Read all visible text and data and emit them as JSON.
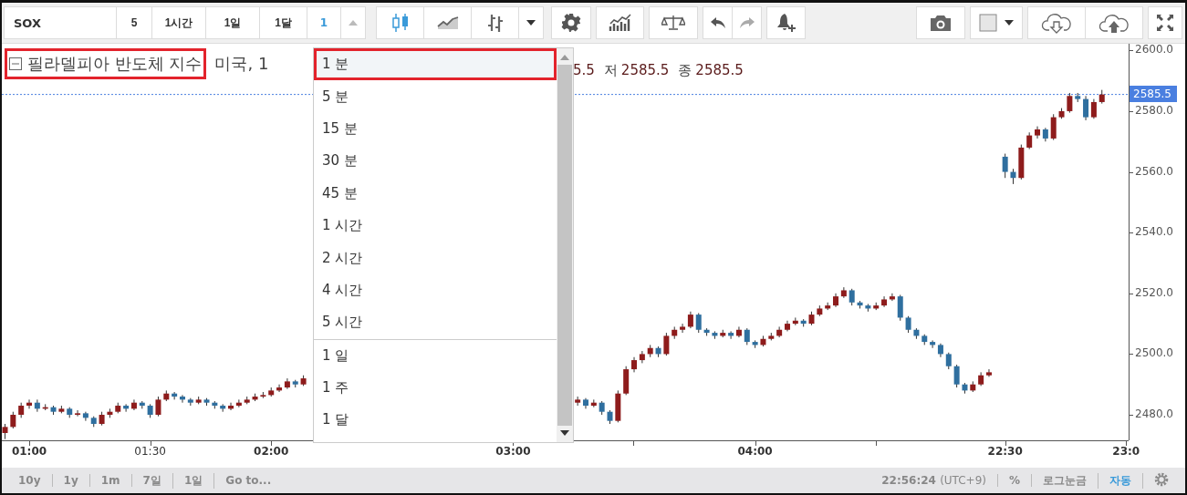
{
  "toolbar": {
    "symbol": "SOX",
    "intervals": [
      "5",
      "1시간",
      "1일",
      "1달"
    ],
    "interval_input": "1",
    "chart_styles": [
      {
        "kind": "candles",
        "selected": true
      },
      {
        "kind": "line",
        "selected": false
      },
      {
        "kind": "bars",
        "selected": false
      }
    ],
    "history": [
      {
        "kind": "undo",
        "disabled": false
      },
      {
        "kind": "redo",
        "disabled": true
      }
    ]
  },
  "legend": {
    "title": "필라델피아 반도체 지수",
    "highlighted": true,
    "exchange": "미국, 1",
    "fields": [
      {
        "value": "5.5"
      },
      {
        "label": "저",
        "value": "2585.5"
      },
      {
        "label": "종",
        "value": "2585.5"
      }
    ]
  },
  "interval_menu": {
    "groups": [
      {
        "items": [
          {
            "label": "1 분",
            "selected": true,
            "highlighted": true
          },
          {
            "label": "5 분",
            "selected": false,
            "highlighted": false
          },
          {
            "label": "15 분",
            "selected": false,
            "highlighted": false
          },
          {
            "label": "30 분",
            "selected": false,
            "highlighted": false
          },
          {
            "label": "45 분",
            "selected": false,
            "highlighted": false
          },
          {
            "label": "1 시간",
            "selected": false,
            "highlighted": false
          },
          {
            "label": "2 시간",
            "selected": false,
            "highlighted": false
          },
          {
            "label": "4 시간",
            "selected": false,
            "highlighted": false
          },
          {
            "label": "5 시간",
            "selected": false,
            "highlighted": false
          }
        ]
      },
      {
        "items": [
          {
            "label": "1 일",
            "selected": false,
            "highlighted": false
          },
          {
            "label": "1 주",
            "selected": false,
            "highlighted": false
          },
          {
            "label": "1 달",
            "selected": false,
            "highlighted": false
          }
        ]
      }
    ]
  },
  "chart_data": {
    "type": "candlestick",
    "ylim": [
      2471.6,
      2602.2
    ],
    "ref_lines": [
      {
        "axis": "y",
        "value": 2585.5
      }
    ],
    "yticks": [
      {
        "value": 2600,
        "label": "2600.0"
      },
      {
        "value": 2580,
        "label": "2580.0"
      },
      {
        "value": 2560,
        "label": "2560.0"
      },
      {
        "value": 2540,
        "label": "2540.0"
      },
      {
        "value": 2520,
        "label": "2520.0"
      },
      {
        "value": 2500,
        "label": "2500.0"
      },
      {
        "value": 2480,
        "label": "2480.0"
      }
    ],
    "categories": [
      null,
      null,
      null,
      "01:00",
      null,
      null,
      null,
      null,
      null,
      null,
      null,
      null,
      null,
      null,
      null,
      null,
      null,
      null,
      "01:30",
      null,
      null,
      null,
      null,
      null,
      null,
      null,
      null,
      null,
      null,
      null,
      null,
      null,
      null,
      "02:00",
      null,
      null,
      null,
      null,
      null,
      null,
      null,
      null,
      null,
      null,
      null,
      null,
      null,
      null,
      null,
      null,
      null,
      null,
      null,
      null,
      null,
      null,
      null,
      null,
      null,
      null,
      null,
      null,
      null,
      "03:00",
      null,
      null,
      null,
      null,
      null,
      null,
      null,
      null,
      null,
      null,
      null,
      null,
      null,
      null,
      null,
      null,
      null,
      null,
      null,
      null,
      null,
      null,
      null,
      null,
      null,
      null,
      null,
      null,
      null,
      "04:00",
      null,
      null,
      null,
      null,
      null,
      null,
      null,
      null,
      null,
      null,
      null,
      null,
      null,
      null,
      null,
      null,
      null,
      null,
      null,
      null,
      null,
      null,
      null,
      null,
      null,
      null,
      null,
      null,
      null,
      null,
      "22:30",
      null,
      null,
      null,
      null,
      null,
      null,
      null,
      null,
      null,
      null,
      null,
      null,
      null,
      null,
      "23:0"
    ],
    "ohlc": [
      [
        2474,
        2477,
        2472,
        2476
      ],
      [
        2476,
        2481,
        2475.5,
        2480
      ],
      [
        2480,
        2484,
        2479,
        2483
      ],
      [
        2483,
        2485,
        2482,
        2484
      ],
      [
        2484,
        2485,
        2481,
        2482
      ],
      [
        2482,
        2483.5,
        2481.5,
        2482.5
      ],
      [
        2482.5,
        2483,
        2480,
        2481
      ],
      [
        2481,
        2483,
        2480.5,
        2482
      ],
      [
        2482,
        2482.5,
        2479,
        2480
      ],
      [
        2480,
        2481.5,
        2479.5,
        2480.5
      ],
      [
        2480.5,
        2481,
        2478,
        2479
      ],
      [
        2479,
        2479.5,
        2476,
        2477
      ],
      [
        2477,
        2481,
        2476.5,
        2480
      ],
      [
        2480,
        2482,
        2479,
        2481
      ],
      [
        2481,
        2484,
        2480.5,
        2483
      ],
      [
        2483,
        2483.5,
        2481,
        2482
      ],
      [
        2482,
        2485,
        2481.5,
        2484
      ],
      [
        2484,
        2484.5,
        2482,
        2483
      ],
      [
        2483,
        2483.5,
        2479,
        2480
      ],
      [
        2480,
        2486,
        2479.5,
        2485
      ],
      [
        2485,
        2488,
        2484.5,
        2487
      ],
      [
        2487,
        2487.5,
        2485,
        2486
      ],
      [
        2486,
        2486.5,
        2484,
        2485
      ],
      [
        2485,
        2485.5,
        2483,
        2484
      ],
      [
        2484,
        2486,
        2483.5,
        2485
      ],
      [
        2485,
        2485.5,
        2483,
        2484
      ],
      [
        2484,
        2484.5,
        2482,
        2483
      ],
      [
        2483,
        2483.5,
        2481,
        2482
      ],
      [
        2482,
        2484,
        2481.5,
        2483
      ],
      [
        2483,
        2485,
        2482.5,
        2484
      ],
      [
        2484,
        2486,
        2483.5,
        2485
      ],
      [
        2485,
        2487,
        2484.5,
        2486
      ],
      [
        2486,
        2487.5,
        2485.5,
        2486.5
      ],
      [
        2486.5,
        2489,
        2486,
        2488
      ],
      [
        2488,
        2490,
        2487.5,
        2489
      ],
      [
        2489,
        2492,
        2488.5,
        2491
      ],
      [
        2491,
        2491.5,
        2489,
        2490
      ],
      [
        2490,
        2493,
        2489.5,
        2492
      ],
      null,
      null,
      null,
      null,
      null,
      null,
      null,
      null,
      null,
      null,
      null,
      null,
      null,
      null,
      null,
      null,
      null,
      null,
      null,
      null,
      null,
      null,
      null,
      null,
      null,
      null,
      null,
      null,
      null,
      null,
      null,
      null,
      null,
      [
        2484,
        2486,
        2483,
        2485
      ],
      [
        2485,
        2485.5,
        2482,
        2483
      ],
      [
        2483,
        2485,
        2482.5,
        2484
      ],
      [
        2484,
        2484.5,
        2480,
        2481
      ],
      [
        2481,
        2481.5,
        2477,
        2478
      ],
      [
        2478,
        2488,
        2477.5,
        2487
      ],
      [
        2487,
        2496,
        2486.5,
        2495
      ],
      [
        2495,
        2499,
        2494,
        2498
      ],
      [
        2498,
        2501,
        2497,
        2500
      ],
      [
        2500,
        2503,
        2499,
        2502
      ],
      [
        2502,
        2502.5,
        2499,
        2500
      ],
      [
        2500,
        2507,
        2499.5,
        2506
      ],
      [
        2506,
        2509,
        2505,
        2508
      ],
      [
        2508,
        2510,
        2507,
        2509
      ],
      [
        2509,
        2514,
        2508.5,
        2513
      ],
      [
        2513,
        2513.5,
        2507,
        2508
      ],
      [
        2508,
        2508.5,
        2506,
        2507
      ],
      [
        2507,
        2507.5,
        2505,
        2506
      ],
      [
        2506,
        2508,
        2505.5,
        2507
      ],
      [
        2507,
        2507.5,
        2505,
        2506
      ],
      [
        2506,
        2509,
        2505.5,
        2508
      ],
      [
        2508,
        2508.5,
        2503,
        2504
      ],
      [
        2504,
        2504.5,
        2502,
        2503
      ],
      [
        2503,
        2506,
        2502.5,
        2505
      ],
      [
        2505,
        2507,
        2504.5,
        2506
      ],
      [
        2506,
        2509,
        2505.5,
        2508
      ],
      [
        2508,
        2511,
        2507.5,
        2510
      ],
      [
        2510,
        2512,
        2509.5,
        2511
      ],
      [
        2511,
        2511.5,
        2509,
        2510
      ],
      [
        2510,
        2514,
        2509.5,
        2513
      ],
      [
        2513,
        2516,
        2512.5,
        2515
      ],
      [
        2515,
        2517,
        2514.5,
        2516
      ],
      [
        2516,
        2520,
        2515.5,
        2519
      ],
      [
        2519,
        2522,
        2518.5,
        2521
      ],
      [
        2521,
        2521.5,
        2516,
        2517
      ],
      [
        2517,
        2517.5,
        2515,
        2516
      ],
      [
        2516,
        2516.5,
        2514,
        2515
      ],
      [
        2515,
        2517,
        2514.5,
        2516
      ],
      [
        2516,
        2519,
        2515.5,
        2518
      ],
      [
        2518,
        2520,
        2517.5,
        2519
      ],
      [
        2519,
        2519.5,
        2511,
        2512
      ],
      [
        2512,
        2512.5,
        2507,
        2508
      ],
      [
        2508,
        2508.5,
        2505,
        2506
      ],
      [
        2506,
        2506.5,
        2503,
        2504
      ],
      [
        2504,
        2504.5,
        2502,
        2503
      ],
      [
        2503,
        2503.5,
        2499,
        2500
      ],
      [
        2500,
        2500.5,
        2495,
        2496
      ],
      [
        2496,
        2496.5,
        2489,
        2490
      ],
      [
        2490,
        2490.5,
        2487,
        2488
      ],
      [
        2488,
        2491,
        2487.5,
        2490
      ],
      [
        2490,
        2494,
        2489.5,
        2493
      ],
      [
        2493,
        2495,
        2492.5,
        2494
      ],
      null,
      [
        2565,
        2566,
        2558,
        2560
      ],
      [
        2560,
        2561,
        2556,
        2558
      ],
      [
        2558,
        2569,
        2557.5,
        2568
      ],
      [
        2568,
        2573,
        2567.5,
        2572
      ],
      [
        2572,
        2575,
        2571,
        2574
      ],
      [
        2574,
        2574.5,
        2570,
        2571
      ],
      [
        2571,
        2579,
        2570.5,
        2578
      ],
      [
        2578,
        2581,
        2577.5,
        2580
      ],
      [
        2580,
        2586,
        2579.5,
        2585
      ],
      [
        2585,
        2586,
        2583,
        2584
      ],
      [
        2584,
        2585,
        2577,
        2578
      ],
      [
        2578,
        2584,
        2577.5,
        2583
      ],
      [
        2583,
        2587,
        2582.5,
        2585.5
      ],
      null,
      null,
      null
    ]
  },
  "price_axis": {
    "last_price": "2585.5"
  },
  "time_axis_emphasis": [
    true,
    false,
    true,
    true,
    true,
    true,
    true
  ],
  "bottom_bar": {
    "ranges": [
      "10y",
      "1y",
      "1m",
      "7일",
      "1일"
    ],
    "goto": "Go to...",
    "time": "22:56:24",
    "timezone": "(UTC+9)",
    "scale_modes": [
      {
        "label": "%",
        "selected": false
      },
      {
        "label": "로그눈금",
        "selected": false
      },
      {
        "label": "자동",
        "selected": true
      }
    ]
  }
}
